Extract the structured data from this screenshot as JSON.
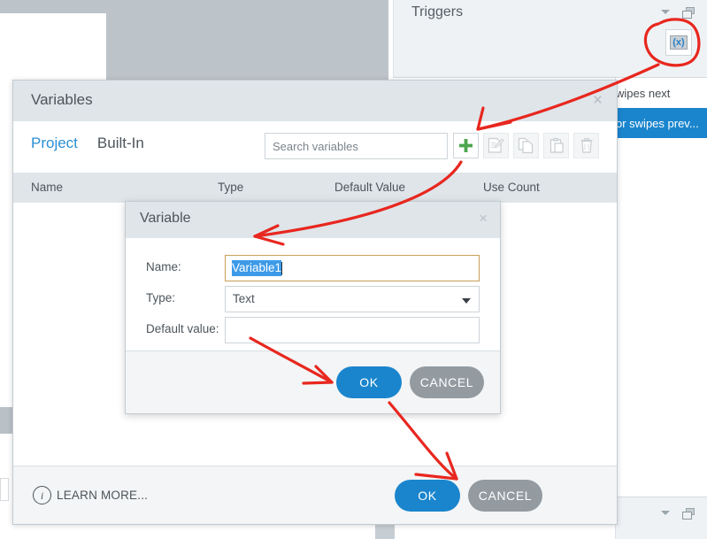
{
  "triggers_panel": {
    "title": "Triggers",
    "chevron_icon": "chevron-down-icon",
    "restore_icon": "restore-window-icon",
    "toolbar": [
      {
        "name": "new-trigger-button",
        "icon": "new-document-icon",
        "disabled": false
      },
      {
        "name": "edit-trigger-button",
        "icon": "edit-pencil-icon",
        "disabled": false
      },
      {
        "name": "copy-trigger-button",
        "icon": "copy-icon",
        "disabled": false
      },
      {
        "name": "paste-trigger-button",
        "icon": "paste-icon",
        "disabled": true
      },
      {
        "name": "delete-trigger-button",
        "icon": "trash-icon",
        "disabled": false
      },
      {
        "name": "move-up-button",
        "icon": "triangle-up-icon",
        "disabled": false
      },
      {
        "name": "move-down-button",
        "icon": "triangle-down-icon",
        "disabled": true
      }
    ],
    "variables_button": {
      "label": "(x)",
      "name": "variables-button"
    }
  },
  "trigger_list": {
    "rows": [
      {
        "text": "wipes next",
        "selected": false
      },
      {
        "text": "or swipes prev...",
        "selected": true
      }
    ]
  },
  "bottom_panel": {
    "chevron_icon": "chevron-down-icon",
    "restore_icon": "restore-window-icon"
  },
  "variables_dialog": {
    "title": "Variables",
    "close_label": "×",
    "tabs": [
      {
        "label": "Project",
        "active": true
      },
      {
        "label": "Built-In",
        "active": false
      }
    ],
    "search": {
      "value": "",
      "placeholder": "Search variables"
    },
    "toolbar": [
      {
        "name": "add-variable-button",
        "icon": "plus-icon",
        "disabled": false
      },
      {
        "name": "edit-variable-button",
        "icon": "edit-pencil-icon",
        "disabled": true
      },
      {
        "name": "copy-variable-button",
        "icon": "copy-icon",
        "disabled": true
      },
      {
        "name": "paste-variable-button",
        "icon": "paste-icon",
        "disabled": true
      },
      {
        "name": "delete-variable-button",
        "icon": "trash-icon",
        "disabled": true
      }
    ],
    "columns": [
      "Name",
      "Type",
      "Default Value",
      "Use Count"
    ],
    "rows": [],
    "footer": {
      "learn_more": "LEARN MORE...",
      "info_icon": "info-icon",
      "ok": "OK",
      "cancel": "CANCEL"
    }
  },
  "variable_dialog": {
    "title": "Variable",
    "close_label": "×",
    "fields": {
      "name_label": "Name:",
      "name_value": "Variable1",
      "type_label": "Type:",
      "type_value": "Text",
      "default_label": "Default value:",
      "default_value": ""
    },
    "footer": {
      "ok": "OK",
      "cancel": "CANCEL"
    }
  },
  "annotations": {
    "color": "#e8271f",
    "marks": [
      {
        "name": "circle-variables-button",
        "shape": "ellipse"
      },
      {
        "name": "arrow-to-add-variable",
        "shape": "arrow"
      },
      {
        "name": "arrow-to-variable-dialog",
        "shape": "arrow"
      },
      {
        "name": "arrow-to-inner-ok",
        "shape": "arrow"
      },
      {
        "name": "arrow-to-outer-ok",
        "shape": "arrow"
      }
    ]
  },
  "colors": {
    "accent_blue": "#1a85cd",
    "tab_blue": "#2a8fd4",
    "selection_blue": "#3d9ae8",
    "plus_green": "#4ca64c",
    "cancel_gray": "#939ba1",
    "titlebar_gray": "#dfe5e9",
    "annotation_red": "#e8271f"
  }
}
